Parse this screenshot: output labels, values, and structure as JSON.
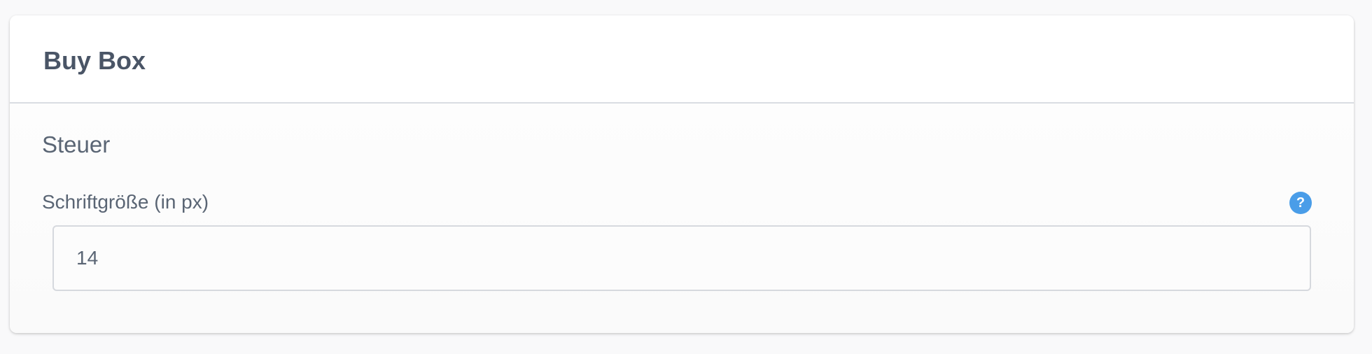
{
  "card": {
    "title": "Buy Box"
  },
  "section": {
    "title": "Steuer"
  },
  "font_size_field": {
    "label": "Schriftgröße (in px)",
    "value": "14",
    "help_icon_glyph": "?"
  },
  "colors": {
    "accent": "#4a9de8",
    "text": "#4a5566",
    "border": "#d6d9de"
  }
}
